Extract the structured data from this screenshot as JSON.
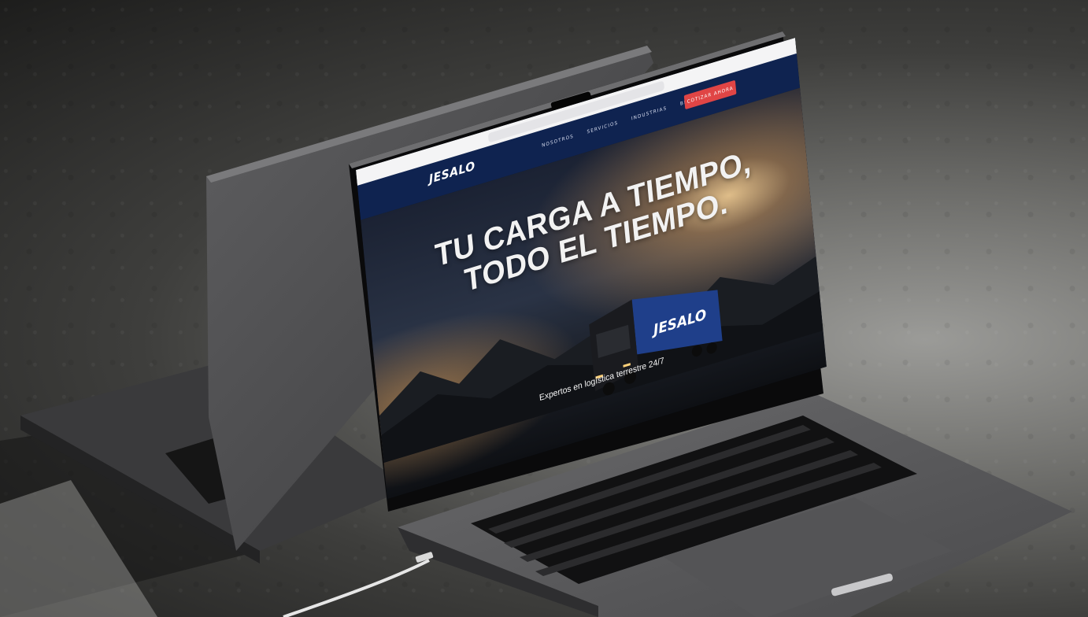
{
  "site": {
    "logo_text": "JESALO",
    "nav_links": [
      "NOSOTROS",
      "SERVICIOS",
      "INDUSTRIAS",
      "BLOG"
    ],
    "cta_label": "COTIZAR AHORA",
    "hero_title_line1": "TU CARGA A TIEMPO,",
    "hero_title_line2": "TODO EL TIEMPO.",
    "hero_subtitle": "Expertos en logística terrestre 24/7",
    "truck_logo": "JESALO"
  },
  "colors": {
    "nav_background": "#0f2350",
    "cta_background": "#e04545",
    "laptop_body": "#5a5a5c"
  },
  "icons": [
    "sidebar-icon",
    "share-icon",
    "new-tab-icon",
    "tabs-overview-icon",
    "download-icon"
  ]
}
